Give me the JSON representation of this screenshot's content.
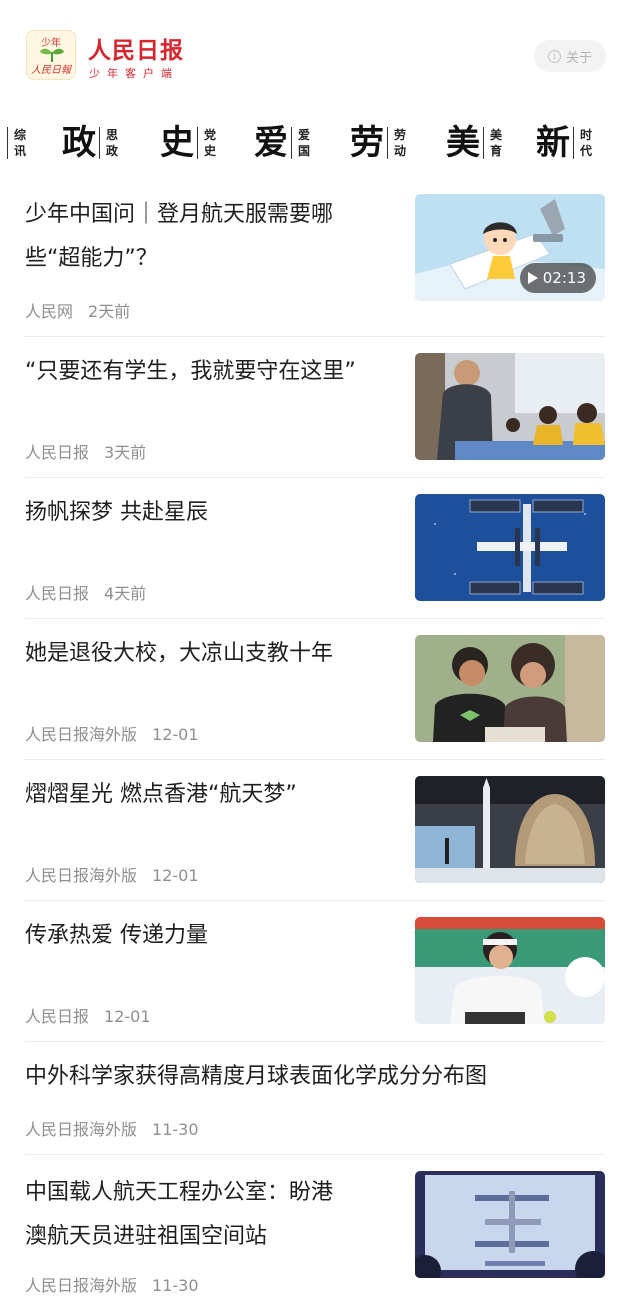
{
  "header": {
    "logo_text_top": "少年",
    "logo_text_bottom": "人民日報",
    "brand_title": "人民日报",
    "brand_subtitle": "少年客户端",
    "about_icon": "info-icon",
    "about_label": "关于",
    "brand_color": "#d8262f"
  },
  "categories": [
    {
      "big": "",
      "small": "综讯"
    },
    {
      "big": "政",
      "small": "思政"
    },
    {
      "big": "史",
      "small": "党史"
    },
    {
      "big": "爱",
      "small": "爱国"
    },
    {
      "big": "劳",
      "small": "劳动"
    },
    {
      "big": "美",
      "small": "美育"
    },
    {
      "big": "新",
      "small": "时代"
    }
  ],
  "news": [
    {
      "title_line1": "少年中国问｜登月航天服需要哪",
      "title_line2": "些“超能力”？",
      "source": "人民网",
      "time": "2天前",
      "duration": "02:13"
    },
    {
      "title_line1": "“只要还有学生，我就要守在这里”",
      "title_line2": "",
      "source": "人民日报",
      "time": "3天前"
    },
    {
      "title_line1": "扬帆探梦 共赴星辰",
      "title_line2": "",
      "source": "人民日报",
      "time": "4天前"
    },
    {
      "title_line1": "她是退役大校，大凉山支教十年",
      "title_line2": "",
      "source": "人民日报海外版",
      "time": "12-01"
    },
    {
      "title_line1": "熠熠星光 燃点香港“航天梦”",
      "title_line2": "",
      "source": "人民日报海外版",
      "time": "12-01"
    },
    {
      "title_line1": "传承热爱 传递力量",
      "title_line2": "",
      "source": "人民日报",
      "time": "12-01"
    },
    {
      "title_line1": "中外科学家获得高精度月球表面化学成分分布图",
      "title_line2": "",
      "source": "人民日报海外版",
      "time": "11-30"
    },
    {
      "title_line1": "中国载人航天工程办公室：盼港",
      "title_line2": "澳航天员进驻祖国空间站",
      "source": "人民日报海外版",
      "time": "11-30"
    }
  ]
}
